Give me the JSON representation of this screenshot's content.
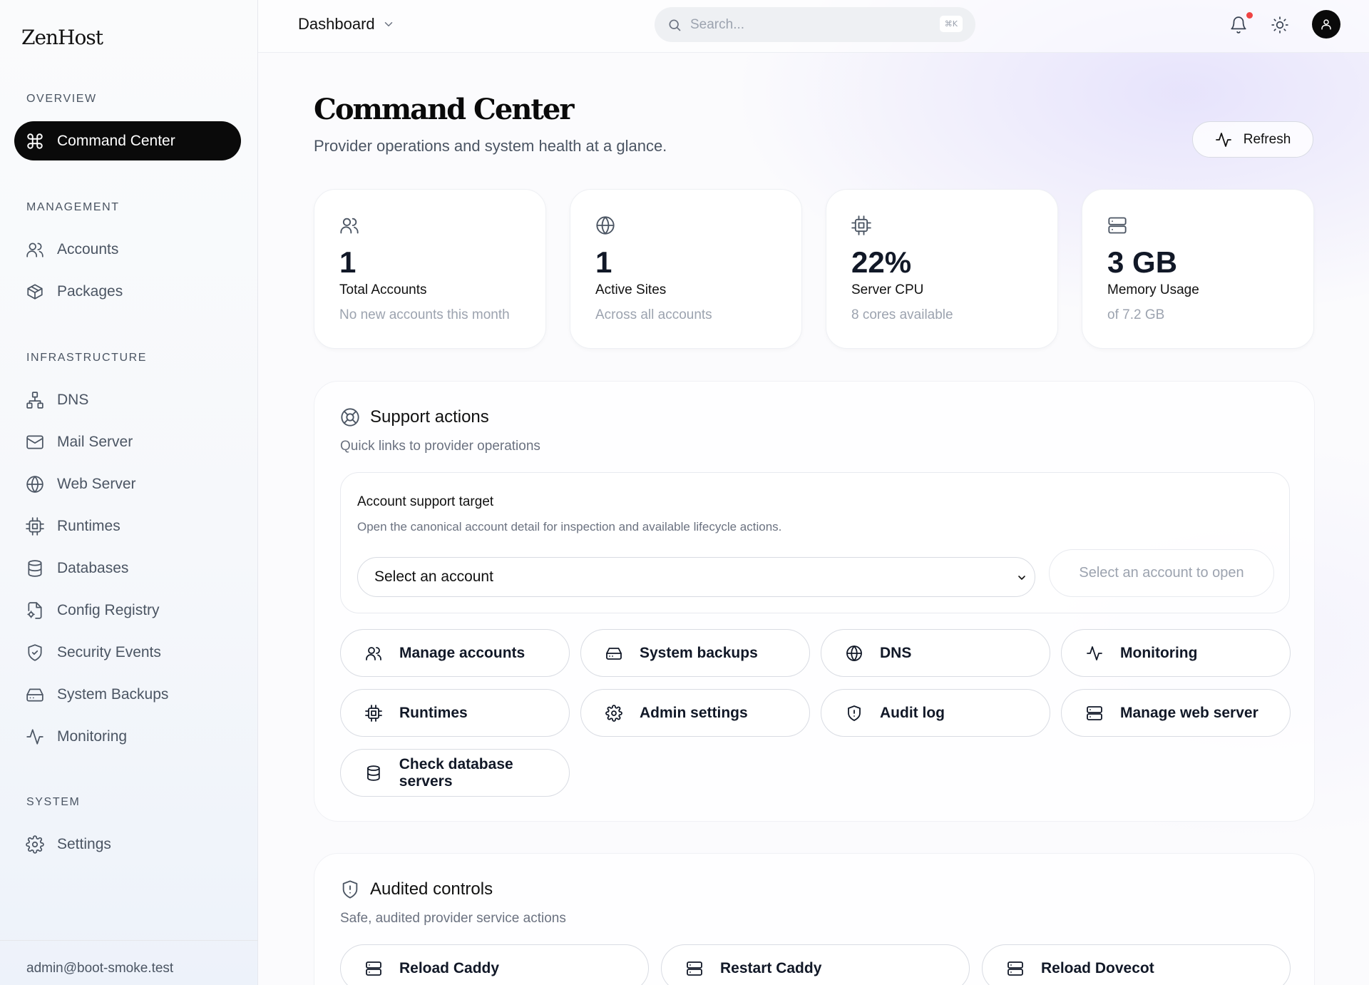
{
  "brand": "ZenHost",
  "sidebar": {
    "sections": [
      {
        "title": "OVERVIEW"
      },
      {
        "title": "MANAGEMENT"
      },
      {
        "title": "INFRASTRUCTURE"
      },
      {
        "title": "SYSTEM"
      }
    ],
    "items": [
      {
        "label": "Command Center",
        "icon": "command-icon",
        "active": true
      },
      {
        "label": "Accounts",
        "icon": "users-icon"
      },
      {
        "label": "Packages",
        "icon": "package-icon"
      },
      {
        "label": "DNS",
        "icon": "network-icon"
      },
      {
        "label": "Mail Server",
        "icon": "mail-icon"
      },
      {
        "label": "Web Server",
        "icon": "globe-icon"
      },
      {
        "label": "Runtimes",
        "icon": "cpu-icon"
      },
      {
        "label": "Databases",
        "icon": "database-icon"
      },
      {
        "label": "Config Registry",
        "icon": "file-cog-icon"
      },
      {
        "label": "Security Events",
        "icon": "shield-check-icon"
      },
      {
        "label": "System Backups",
        "icon": "hard-drive-icon"
      },
      {
        "label": "Monitoring",
        "icon": "activity-icon"
      },
      {
        "label": "Settings",
        "icon": "gear-icon"
      }
    ],
    "footer": "admin@boot-smoke.test"
  },
  "topbar": {
    "crumb": "Dashboard",
    "search_placeholder": "Search...",
    "shortcut": "⌘K"
  },
  "header": {
    "title": "Command Center",
    "subtitle": "Provider operations and system health at a glance.",
    "refresh_label": "Refresh"
  },
  "stats": [
    {
      "value": "1",
      "label": "Total Accounts",
      "hint": "No new accounts this month",
      "icon": "users-icon"
    },
    {
      "value": "1",
      "label": "Active Sites",
      "hint": "Across all accounts",
      "icon": "globe-icon"
    },
    {
      "value": "22%",
      "label": "Server CPU",
      "hint": "8 cores available",
      "icon": "cpu-icon"
    },
    {
      "value": "3 GB",
      "label": "Memory Usage",
      "hint": "of 7.2 GB",
      "icon": "server-icon"
    }
  ],
  "support": {
    "title": "Support actions",
    "subtitle": "Quick links to provider operations",
    "target_title": "Account support target",
    "target_desc": "Open the canonical account detail for inspection and available lifecycle actions.",
    "select_value": "Select an account",
    "open_label": "Select an account to open",
    "actions": [
      {
        "label": "Manage accounts",
        "icon": "users-icon"
      },
      {
        "label": "System backups",
        "icon": "hard-drive-icon"
      },
      {
        "label": "DNS",
        "icon": "globe-icon"
      },
      {
        "label": "Monitoring",
        "icon": "activity-icon"
      },
      {
        "label": "Runtimes",
        "icon": "cpu-icon"
      },
      {
        "label": "Admin settings",
        "icon": "gear-icon"
      },
      {
        "label": "Audit log",
        "icon": "shield-alert-icon"
      },
      {
        "label": "Manage web server",
        "icon": "server-icon"
      },
      {
        "label": "Check database servers",
        "icon": "database-icon"
      }
    ]
  },
  "audited": {
    "title": "Audited controls",
    "subtitle": "Safe, audited provider service actions",
    "actions": [
      {
        "label": "Reload Caddy",
        "icon": "server-icon"
      },
      {
        "label": "Restart Caddy",
        "icon": "server-icon"
      },
      {
        "label": "Reload Dovecot",
        "icon": "server-icon"
      }
    ]
  },
  "colors": {
    "active_nav_bg": "#0a0a0a",
    "notification_dot": "#ef4444",
    "accent_gradient": "#d6d0fa"
  }
}
